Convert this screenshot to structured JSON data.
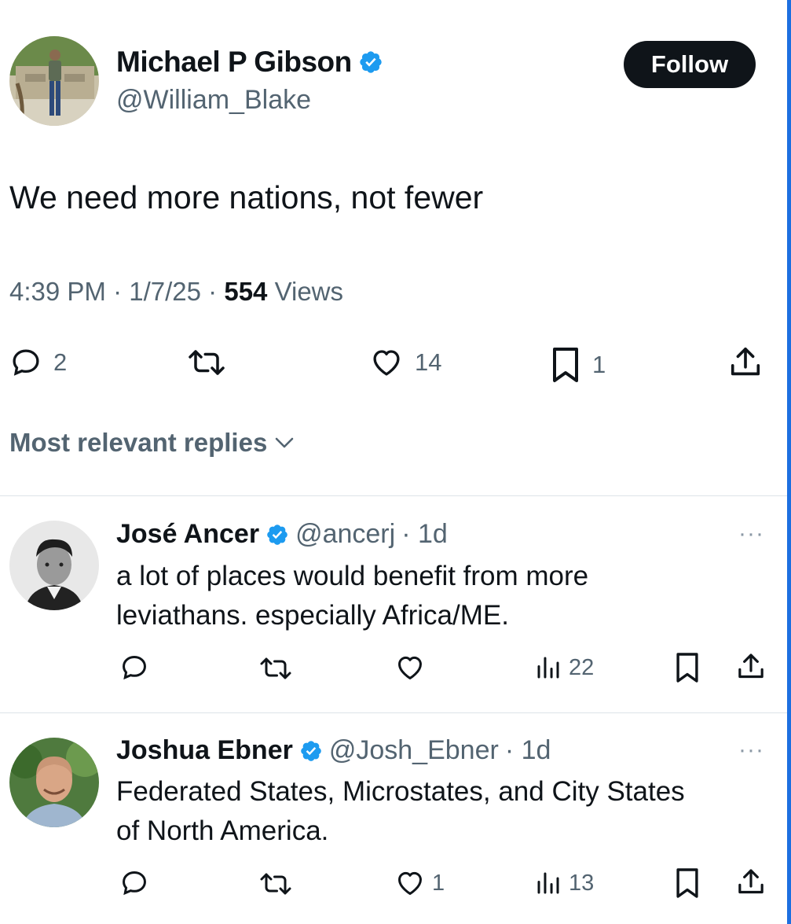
{
  "main_tweet": {
    "author_name": "Michael P Gibson",
    "handle": "@William_Blake",
    "follow_label": "Follow",
    "text": "We need more nations, not fewer",
    "time": "4:39 PM",
    "date": "1/7/25",
    "views_count": "554",
    "views_label": "Views",
    "separator": "·",
    "replies": "2",
    "likes": "14",
    "bookmarks": "1"
  },
  "replies_header": "Most relevant replies",
  "replies": [
    {
      "author_name": "José Ancer",
      "handle": "@ancerj",
      "age": "· 1d",
      "text_line1": "a lot of places would benefit from more",
      "text_line2": "leviathans. especially Africa/ME.",
      "likes": "",
      "views": "22",
      "more": "···"
    },
    {
      "author_name": "Joshua Ebner",
      "handle": "@Josh_Ebner",
      "age": "· 1d",
      "text_line1": "Federated States, Microstates, and City States",
      "text_line2": "of North America.",
      "likes": "1",
      "views": "13",
      "more": "···"
    }
  ],
  "colors": {
    "text": "#0f1419",
    "secondary": "#536471",
    "verified": "#1d9bf0",
    "follow_bg": "#0f1419",
    "divider": "#dde3e8"
  },
  "icons": [
    "verified-badge-icon",
    "reply-icon",
    "retweet-icon",
    "like-icon",
    "bookmark-icon",
    "share-icon",
    "views-icon",
    "chevron-down-icon",
    "more-icon"
  ]
}
